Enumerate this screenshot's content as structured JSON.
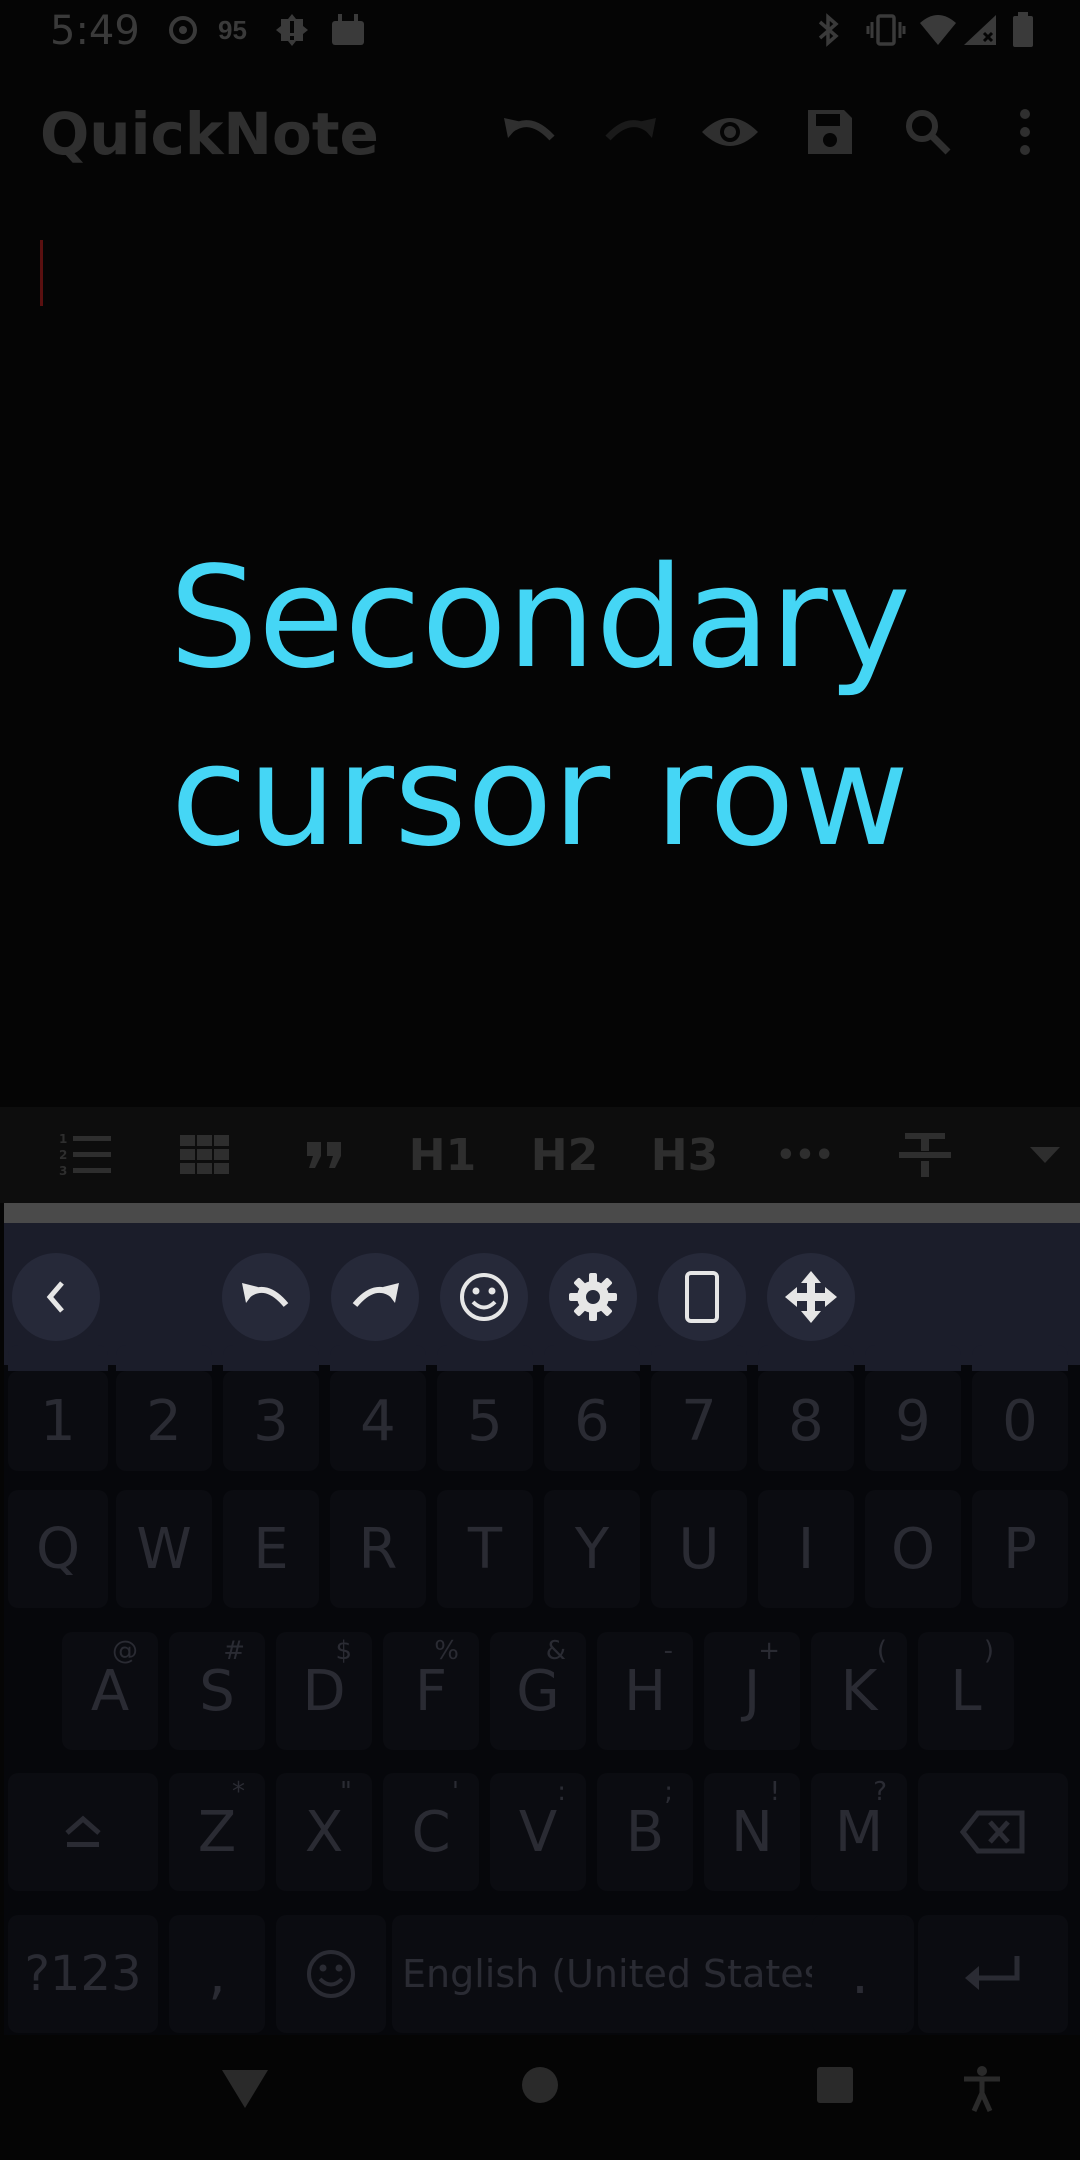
{
  "status_bar": {
    "time": "5:49",
    "notification_count": "95"
  },
  "app_bar": {
    "title": "QuickNote"
  },
  "overlay": {
    "line1": "Secondary",
    "line2": "cursor row"
  },
  "markdown_toolbar": {
    "h1": "H1",
    "h2": "H2",
    "h3": "H3",
    "more": "•••"
  },
  "keyboard": {
    "number_row": [
      "1",
      "2",
      "3",
      "4",
      "5",
      "6",
      "7",
      "8",
      "9",
      "0"
    ],
    "row1": [
      "Q",
      "W",
      "E",
      "R",
      "T",
      "Y",
      "U",
      "I",
      "O",
      "P"
    ],
    "row2": [
      {
        "key": "A",
        "hint": "@"
      },
      {
        "key": "S",
        "hint": "#"
      },
      {
        "key": "D",
        "hint": "$"
      },
      {
        "key": "F",
        "hint": "%"
      },
      {
        "key": "G",
        "hint": "&"
      },
      {
        "key": "H",
        "hint": "-"
      },
      {
        "key": "J",
        "hint": "+"
      },
      {
        "key": "K",
        "hint": "("
      },
      {
        "key": "L",
        "hint": ")"
      }
    ],
    "row3": [
      {
        "key": "Z",
        "hint": "*"
      },
      {
        "key": "X",
        "hint": "\""
      },
      {
        "key": "C",
        "hint": "'"
      },
      {
        "key": "V",
        "hint": ":"
      },
      {
        "key": "B",
        "hint": ";"
      },
      {
        "key": "N",
        "hint": "!"
      },
      {
        "key": "M",
        "hint": "?"
      }
    ],
    "symbols_label": "?123",
    "comma": ",",
    "period": ".",
    "space_label": "English (United States)"
  }
}
